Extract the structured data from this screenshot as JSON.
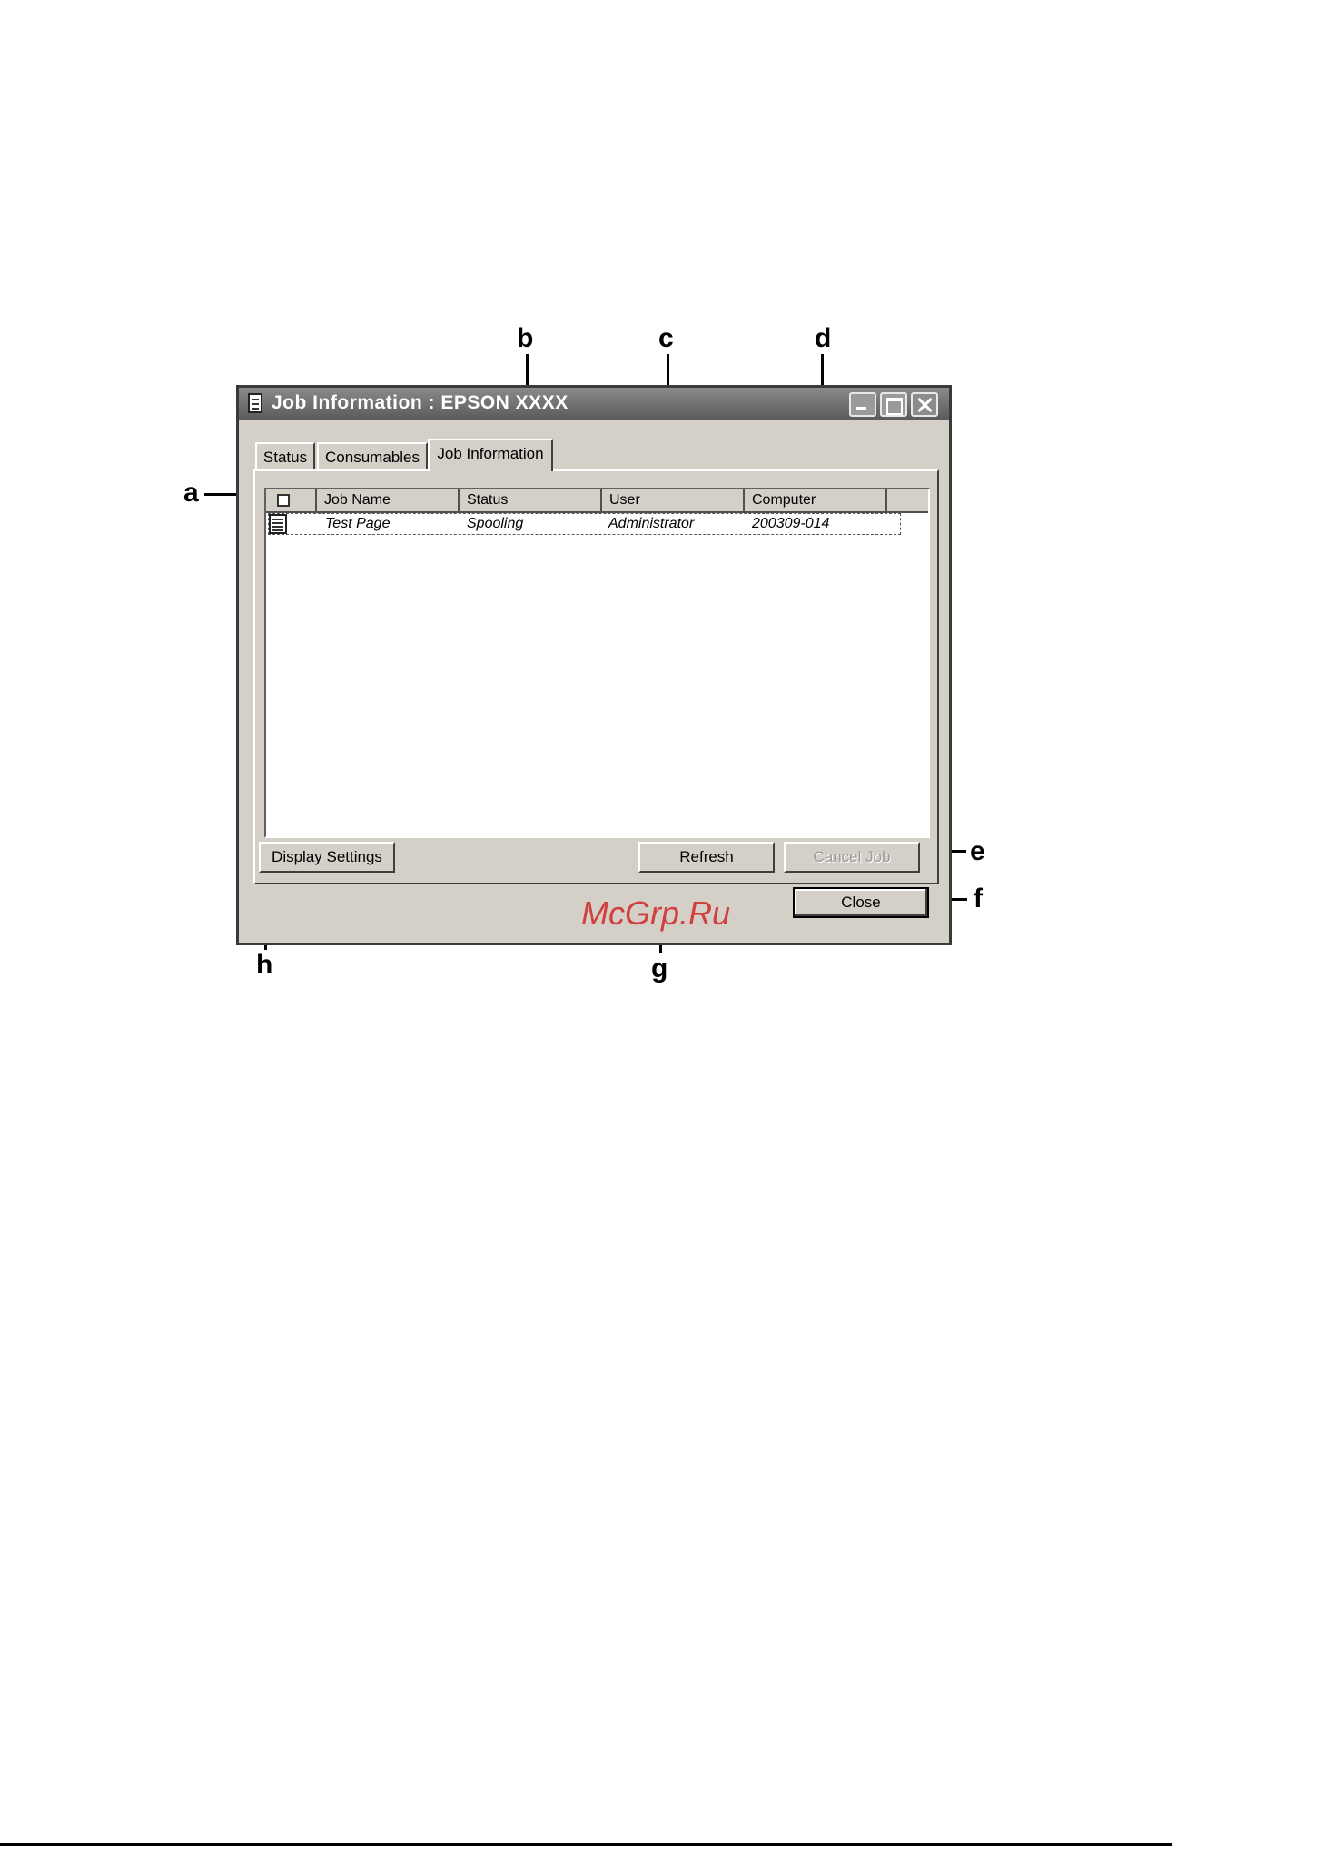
{
  "window": {
    "title": "Job Information : EPSON XXXX",
    "title_icon": "printer-document-icon"
  },
  "tabs": [
    {
      "label": "Status",
      "selected": false
    },
    {
      "label": "Consumables",
      "selected": false
    },
    {
      "label": "Job Information",
      "selected": true
    }
  ],
  "table": {
    "columns": [
      "Job Name",
      "Status",
      "User",
      "Computer"
    ],
    "rows": [
      {
        "job_name": "Test Page",
        "status": "Spooling",
        "user": "Administrator",
        "computer": "200309-014",
        "icon": "print-job-icon"
      }
    ]
  },
  "buttons": {
    "display_settings": "Display Settings",
    "refresh": "Refresh",
    "cancel_job": "Cancel Job",
    "close": "Close"
  },
  "callouts": {
    "a": "a",
    "b": "b",
    "c": "c",
    "d": "d",
    "e": "e",
    "f": "f",
    "g": "g",
    "h": "h"
  },
  "watermark": "McGrp.Ru"
}
